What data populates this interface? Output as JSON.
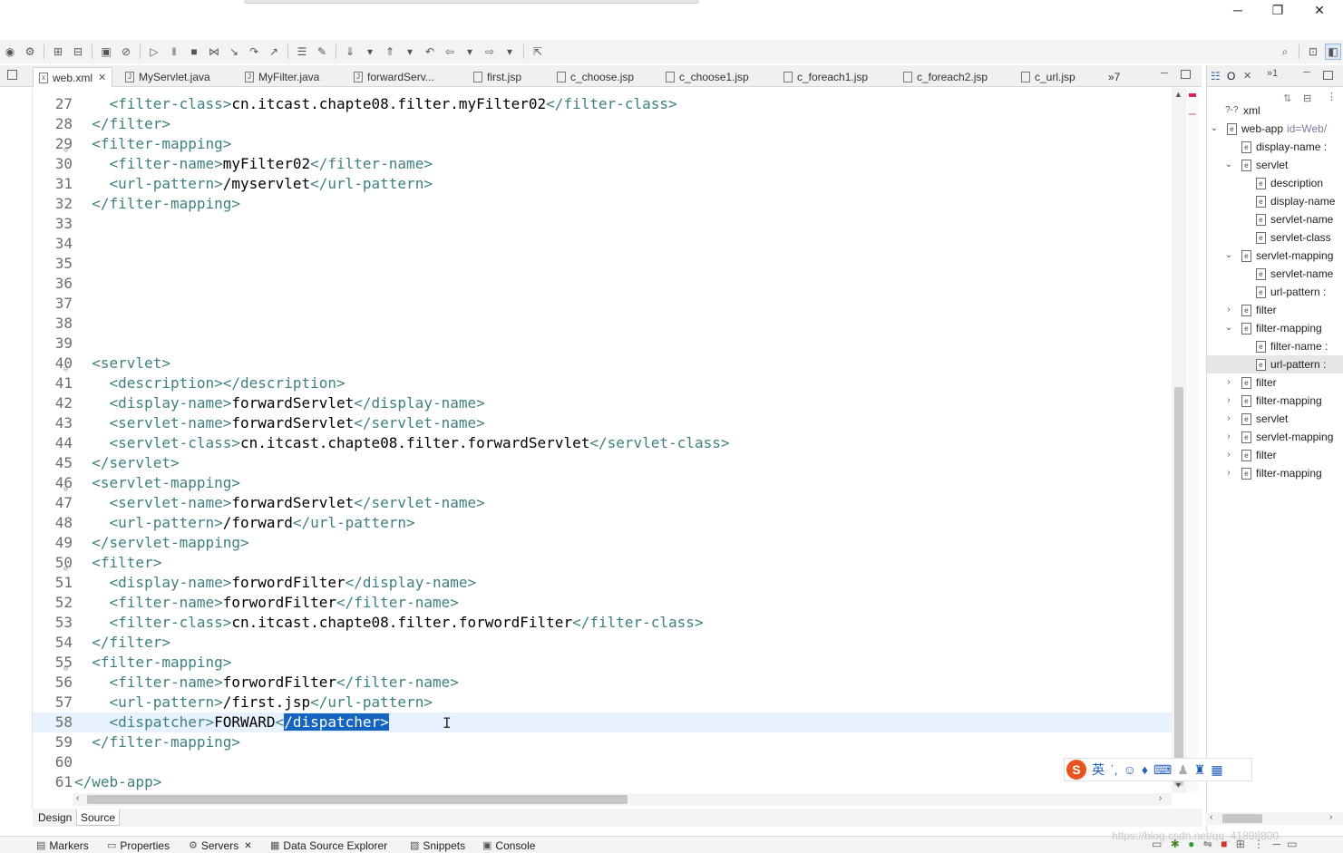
{
  "window": {
    "minimize": "─",
    "restore": "❐",
    "close": "✕"
  },
  "editor_tabs": [
    {
      "label": "web.xml",
      "active": true
    },
    {
      "label": "MyServlet.java"
    },
    {
      "label": "MyFilter.java"
    },
    {
      "label": "forwardServ..."
    },
    {
      "label": "first.jsp"
    },
    {
      "label": "c_choose.jsp"
    },
    {
      "label": "c_choose1.jsp"
    },
    {
      "label": "c_foreach1.jsp"
    },
    {
      "label": "c_foreach2.jsp"
    },
    {
      "label": "c_url.jsp"
    },
    {
      "label": "»7"
    }
  ],
  "code_lines": [
    {
      "n": "27",
      "pre": "    ",
      "parts": [
        [
          "t",
          "<filter-class>"
        ],
        [
          "x",
          "cn.itcast.chapte08.filter.myFilter02"
        ],
        [
          "t",
          "</filter-class>"
        ]
      ]
    },
    {
      "n": "28",
      "pre": "  ",
      "parts": [
        [
          "t",
          "</filter>"
        ]
      ]
    },
    {
      "n": "29",
      "pre": "  ",
      "fold": true,
      "parts": [
        [
          "t",
          "<filter-mapping>"
        ]
      ]
    },
    {
      "n": "30",
      "pre": "    ",
      "parts": [
        [
          "t",
          "<filter-name>"
        ],
        [
          "x",
          "myFilter02"
        ],
        [
          "t",
          "</filter-name>"
        ]
      ]
    },
    {
      "n": "31",
      "pre": "    ",
      "parts": [
        [
          "t",
          "<url-pattern>"
        ],
        [
          "x",
          "/myservlet"
        ],
        [
          "t",
          "</url-pattern>"
        ]
      ]
    },
    {
      "n": "32",
      "pre": "  ",
      "parts": [
        [
          "t",
          "</filter-mapping>"
        ]
      ]
    },
    {
      "n": "33",
      "pre": "",
      "parts": []
    },
    {
      "n": "34",
      "pre": "",
      "parts": []
    },
    {
      "n": "35",
      "pre": "",
      "parts": []
    },
    {
      "n": "36",
      "pre": "",
      "parts": []
    },
    {
      "n": "37",
      "pre": "",
      "parts": []
    },
    {
      "n": "38",
      "pre": "",
      "parts": []
    },
    {
      "n": "39",
      "pre": "",
      "parts": []
    },
    {
      "n": "40",
      "pre": "  ",
      "fold": true,
      "parts": [
        [
          "t",
          "<servlet>"
        ]
      ]
    },
    {
      "n": "41",
      "pre": "    ",
      "parts": [
        [
          "t",
          "<description></description>"
        ]
      ]
    },
    {
      "n": "42",
      "pre": "    ",
      "parts": [
        [
          "t",
          "<display-name>"
        ],
        [
          "x",
          "forwardServlet"
        ],
        [
          "t",
          "</display-name>"
        ]
      ]
    },
    {
      "n": "43",
      "pre": "    ",
      "parts": [
        [
          "t",
          "<servlet-name>"
        ],
        [
          "x",
          "forwardServlet"
        ],
        [
          "t",
          "</servlet-name>"
        ]
      ]
    },
    {
      "n": "44",
      "pre": "    ",
      "parts": [
        [
          "t",
          "<servlet-class>"
        ],
        [
          "x",
          "cn.itcast.chapte08.filter.forwardServlet"
        ],
        [
          "t",
          "</servlet-class>"
        ]
      ]
    },
    {
      "n": "45",
      "pre": "  ",
      "parts": [
        [
          "t",
          "</servlet>"
        ]
      ]
    },
    {
      "n": "46",
      "pre": "  ",
      "fold": true,
      "parts": [
        [
          "t",
          "<servlet-mapping>"
        ]
      ]
    },
    {
      "n": "47",
      "pre": "    ",
      "parts": [
        [
          "t",
          "<servlet-name>"
        ],
        [
          "x",
          "forwardServlet"
        ],
        [
          "t",
          "</servlet-name>"
        ]
      ]
    },
    {
      "n": "48",
      "pre": "    ",
      "parts": [
        [
          "t",
          "<url-pattern>"
        ],
        [
          "x",
          "/forward"
        ],
        [
          "t",
          "</url-pattern>"
        ]
      ]
    },
    {
      "n": "49",
      "pre": "  ",
      "parts": [
        [
          "t",
          "</servlet-mapping>"
        ]
      ]
    },
    {
      "n": "50",
      "pre": "  ",
      "fold": true,
      "parts": [
        [
          "t",
          "<filter>"
        ]
      ]
    },
    {
      "n": "51",
      "pre": "    ",
      "parts": [
        [
          "t",
          "<display-name>"
        ],
        [
          "x",
          "forwordFilter"
        ],
        [
          "t",
          "</display-name>"
        ]
      ]
    },
    {
      "n": "52",
      "pre": "    ",
      "parts": [
        [
          "t",
          "<filter-name>"
        ],
        [
          "x",
          "forwordFilter"
        ],
        [
          "t",
          "</filter-name>"
        ]
      ]
    },
    {
      "n": "53",
      "pre": "    ",
      "parts": [
        [
          "t",
          "<filter-class>"
        ],
        [
          "x",
          "cn.itcast.chapte08.filter.forwordFilter"
        ],
        [
          "t",
          "</filter-class>"
        ]
      ]
    },
    {
      "n": "54",
      "pre": "  ",
      "parts": [
        [
          "t",
          "</filter>"
        ]
      ]
    },
    {
      "n": "55",
      "pre": "  ",
      "fold": true,
      "parts": [
        [
          "t",
          "<filter-mapping>"
        ]
      ]
    },
    {
      "n": "56",
      "pre": "    ",
      "parts": [
        [
          "t",
          "<filter-name>"
        ],
        [
          "x",
          "forwordFilter"
        ],
        [
          "t",
          "</filter-name>"
        ]
      ]
    },
    {
      "n": "57",
      "pre": "    ",
      "parts": [
        [
          "t",
          "<url-pattern>"
        ],
        [
          "x",
          "/first.jsp"
        ],
        [
          "t",
          "</url-pattern>"
        ]
      ]
    },
    {
      "n": "58",
      "pre": "    ",
      "current": true,
      "parts": [
        [
          "t",
          "<dispatcher>"
        ],
        [
          "x",
          "FORWARD"
        ],
        [
          "t",
          "<"
        ],
        [
          "s",
          "/dispatcher>"
        ]
      ]
    },
    {
      "n": "59",
      "pre": "  ",
      "parts": [
        [
          "t",
          "</filter-mapping>"
        ]
      ]
    },
    {
      "n": "60",
      "pre": "",
      "parts": []
    },
    {
      "n": "61",
      "pre": "",
      "parts": [
        [
          "t",
          "</web-app>"
        ]
      ]
    }
  ],
  "editor_bottom_tabs": {
    "design": "Design",
    "source": "Source"
  },
  "outline": {
    "tab_label": "O",
    "nodes": [
      {
        "depth": 0,
        "chev": "",
        "icon": "?-?",
        "label": "xml"
      },
      {
        "depth": 0,
        "chev": "open",
        "icon": "e",
        "label": "web-app",
        "attr": "id=Web/"
      },
      {
        "depth": 1,
        "chev": "",
        "icon": "e",
        "label": "display-name :"
      },
      {
        "depth": 1,
        "chev": "open",
        "icon": "e",
        "label": "servlet"
      },
      {
        "depth": 2,
        "chev": "",
        "icon": "e",
        "label": "description"
      },
      {
        "depth": 2,
        "chev": "",
        "icon": "e",
        "label": "display-name"
      },
      {
        "depth": 2,
        "chev": "",
        "icon": "e",
        "label": "servlet-name"
      },
      {
        "depth": 2,
        "chev": "",
        "icon": "e",
        "label": "servlet-class"
      },
      {
        "depth": 1,
        "chev": "open",
        "icon": "e",
        "label": "servlet-mapping"
      },
      {
        "depth": 2,
        "chev": "",
        "icon": "e",
        "label": "servlet-name"
      },
      {
        "depth": 2,
        "chev": "",
        "icon": "e",
        "label": "url-pattern :"
      },
      {
        "depth": 1,
        "chev": "closed",
        "icon": "e",
        "label": "filter"
      },
      {
        "depth": 1,
        "chev": "open",
        "icon": "e",
        "label": "filter-mapping"
      },
      {
        "depth": 2,
        "chev": "",
        "icon": "e",
        "label": "filter-name :"
      },
      {
        "depth": 2,
        "chev": "",
        "icon": "e",
        "label": "url-pattern :",
        "selected": true
      },
      {
        "depth": 1,
        "chev": "closed",
        "icon": "e",
        "label": "filter"
      },
      {
        "depth": 1,
        "chev": "closed",
        "icon": "e",
        "label": "filter-mapping"
      },
      {
        "depth": 1,
        "chev": "closed",
        "icon": "e",
        "label": "servlet"
      },
      {
        "depth": 1,
        "chev": "closed",
        "icon": "e",
        "label": "servlet-mapping"
      },
      {
        "depth": 1,
        "chev": "closed",
        "icon": "e",
        "label": "filter"
      },
      {
        "depth": 1,
        "chev": "closed",
        "icon": "e",
        "label": "filter-mapping"
      }
    ]
  },
  "bottom_views": [
    {
      "label": "Markers",
      "icon": "markers-icon",
      "glyph": "▤"
    },
    {
      "label": "Properties",
      "icon": "properties-icon",
      "glyph": "▭"
    },
    {
      "label": "Servers",
      "icon": "servers-icon",
      "glyph": "⚙",
      "close": "✕"
    },
    {
      "label": "Data Source Explorer",
      "icon": "data-source-icon",
      "glyph": "▦"
    },
    {
      "label": "Snippets",
      "icon": "snippets-icon",
      "glyph": "▧"
    },
    {
      "label": "Console",
      "icon": "console-icon",
      "glyph": "▣"
    }
  ],
  "ime": {
    "logo": "S",
    "lang": "英"
  },
  "watermark": "https://blog.csdn.net/qq_41898800",
  "colors": {
    "tag": "#3f7f7f",
    "selection": "#1565c0",
    "current_line": "#e8f2fe"
  }
}
